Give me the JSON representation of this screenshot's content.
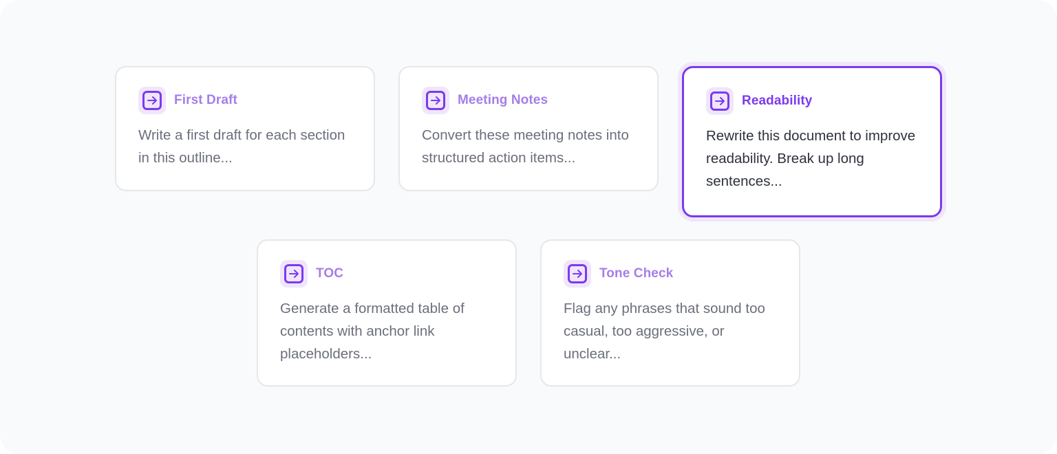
{
  "cards": [
    {
      "title": "First Draft",
      "description": "Write a first draft for each section in this outline...",
      "icon": "arrow-right-square-icon"
    },
    {
      "title": "Meeting Notes",
      "description": "Convert these meeting notes into structured action items...",
      "icon": "arrow-right-square-icon"
    },
    {
      "title": "Readability",
      "description": "Rewrite this document to improve readability. Break up long sentences...",
      "icon": "arrow-right-square-icon",
      "selected": true
    },
    {
      "title": "TOC",
      "description": "Generate a formatted table of contents with anchor link placeholders...",
      "icon": "arrow-right-square-icon"
    },
    {
      "title": "Tone Check",
      "description": "Flag any phrases that sound too casual, too aggressive, or unclear...",
      "icon": "arrow-right-square-icon"
    }
  ],
  "colors": {
    "accent": "#7c3aed",
    "accent_soft": "#a57ee8",
    "icon_bg": "#efe6fc",
    "card_border": "#e6e7ec",
    "page_bg": "#f9fafc"
  }
}
